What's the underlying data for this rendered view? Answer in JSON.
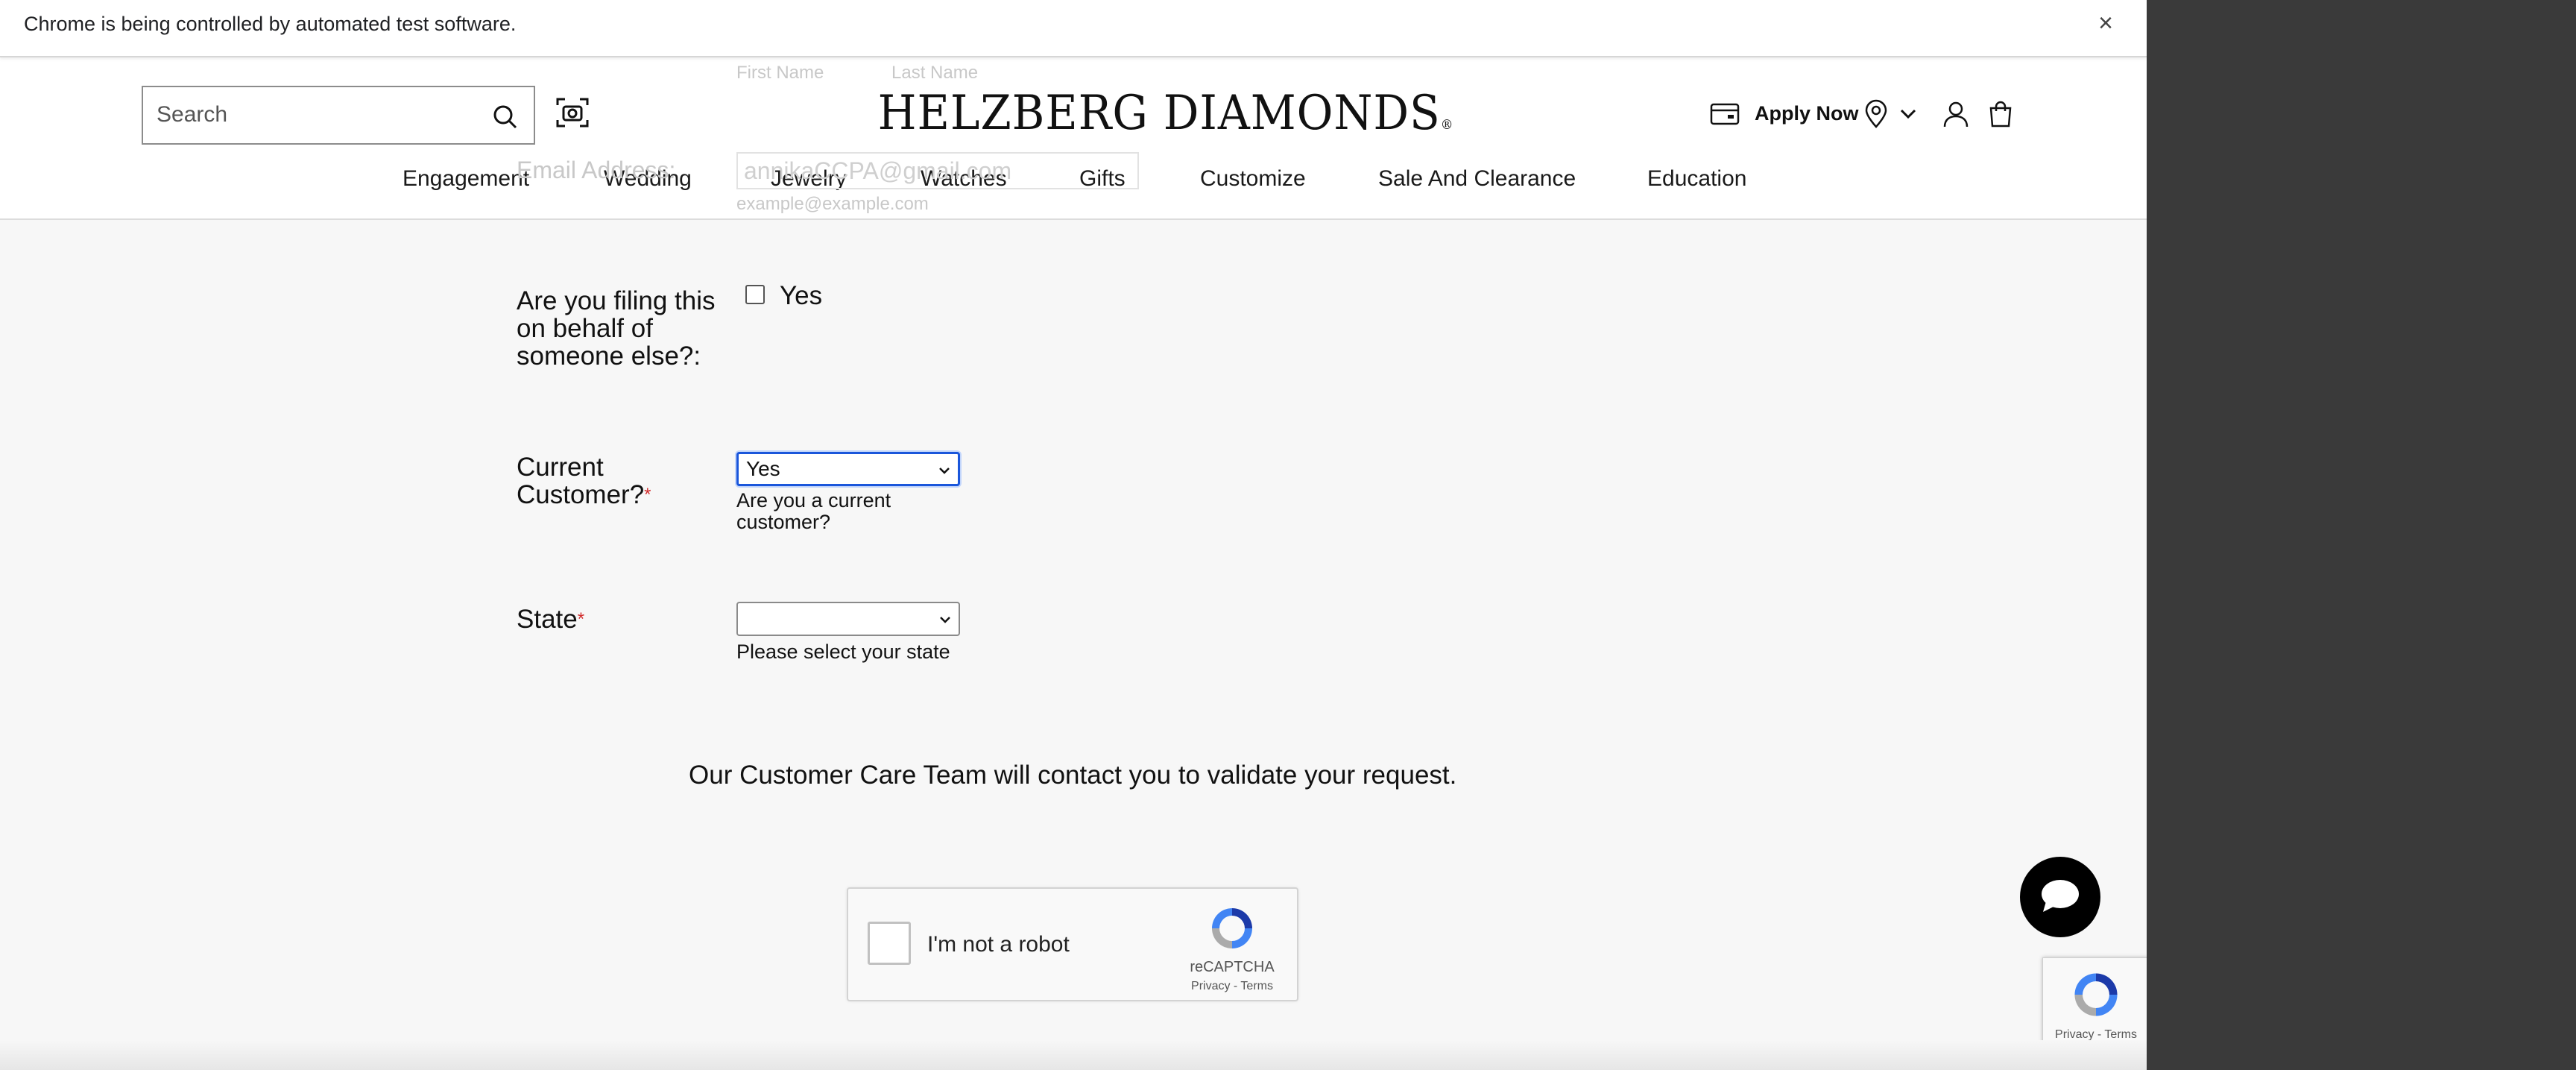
{
  "automation_bar": {
    "message": "Chrome is being controlled by automated test software.",
    "close": "×"
  },
  "header": {
    "search_placeholder": "Search",
    "logo": "HELZBERG DIAMONDS",
    "logo_mark": "®",
    "apply_now": "Apply Now",
    "nav": [
      "Engagement",
      "Wedding",
      "Jewelry",
      "Watches",
      "Gifts",
      "Customize",
      "Sale And Clearance",
      "Education"
    ]
  },
  "ghost_form": {
    "first_name": "First Name",
    "last_name": "Last Name",
    "email_label": "Email Address:",
    "email_value": "annikaCCPA@gmail.com",
    "email_hint": "example@example.com"
  },
  "form": {
    "behalf_label": "Are you filing this on behalf of someone else?:",
    "behalf_option": "Yes",
    "customer_label": "Current Customer?",
    "customer_required": "*",
    "customer_value": "Yes",
    "customer_hint": "Are you a current customer?",
    "state_label": "State",
    "state_required": "*",
    "state_value": "",
    "state_hint": "Please select your state",
    "care_message": "Our Customer Care Team will contact you to validate your request."
  },
  "recaptcha": {
    "label": "I'm not a robot",
    "brand": "reCAPTCHA",
    "links": "Privacy - Terms",
    "badge_links": "Privacy - Terms"
  },
  "colors": {
    "focus_blue": "#1a56db",
    "required_red": "#d12b2b",
    "chat_bg": "#000000"
  }
}
